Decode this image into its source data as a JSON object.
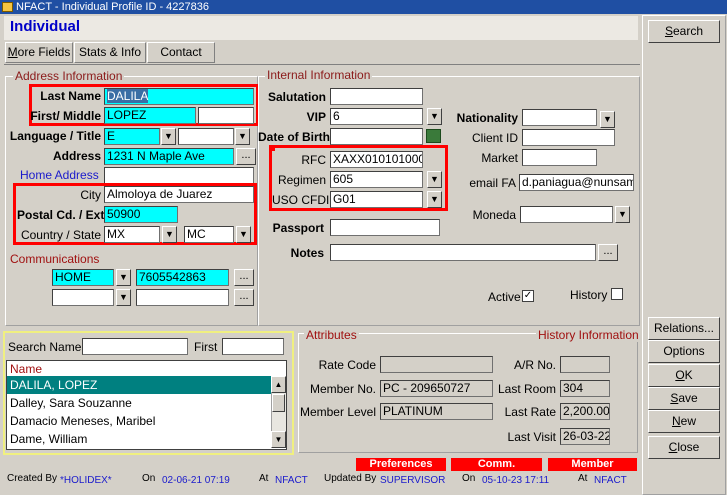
{
  "window": {
    "title": "NFACT - Individual Profile ID - 4227836"
  },
  "page": {
    "title": "Individual"
  },
  "tabs": [
    {
      "label": "More Fields"
    },
    {
      "label": "Stats & Info"
    },
    {
      "label": "Contact"
    }
  ],
  "address": {
    "section": "Address Information",
    "last_name_label": "Last Name",
    "last_name": "DALILA",
    "first_middle_label": "First/ Middle",
    "first_name": "LOPEZ",
    "middle_name": "",
    "language_title_label": "Language / Title",
    "language": "E",
    "title": "",
    "address_label": "Address",
    "address": "1231 N Maple Ave",
    "home_address_label": "Home Address",
    "home_address": "",
    "city_label": "City",
    "city": "Almoloya de Juarez",
    "postal_label": "Postal Cd. / Ext.",
    "postal_code": "50900",
    "country_state_label": "Country / State",
    "country": "MX",
    "state": "MC"
  },
  "communications": {
    "section": "Communications",
    "type1": "HOME",
    "value1": "7605542863",
    "type2": "",
    "value2": ""
  },
  "internal": {
    "section": "Internal Information",
    "salutation_label": "Salutation",
    "salutation": "",
    "vip_label": "VIP",
    "vip": "6",
    "dob_label": "Date of Birth",
    "dob": "",
    "rfc_label": "RFC",
    "rfc": "XAXX010101000",
    "regimen_label": "Regimen",
    "regimen": "605",
    "uso_cfdi_label": "USO CFDI",
    "uso_cfdi": "G01",
    "passport_label": "Passport",
    "passport": "",
    "notes_label": "Notes",
    "notes": "",
    "nationality_label": "Nationality",
    "nationality": "",
    "client_id_label": "Client ID",
    "client_id": "",
    "market_label": "Market",
    "market": "",
    "email_label": "email FA",
    "email": "d.paniagua@nunsam",
    "moneda_label": "Moneda",
    "moneda": "",
    "active_label": "Active",
    "active_mark": "✓",
    "history_label": "History"
  },
  "search": {
    "name_label": "Search Name",
    "name_value": "",
    "first_label": "First",
    "first_value": "",
    "column_header": "Name",
    "results": [
      "DALILA, LOPEZ",
      "Dalley, Sara Souzanne",
      "Damacio Meneses, Maribel",
      "Dame, William"
    ]
  },
  "attributes": {
    "title": "Attributes",
    "history_title": "History Information",
    "rate_code_label": "Rate Code",
    "rate_code": "",
    "member_no_label": "Member No.",
    "member_no": "PC - 209650727",
    "member_level_label": "Member Level",
    "member_level": "PLATINUM",
    "ar_no_label": "A/R No.",
    "ar_no": "",
    "last_room_label": "Last Room",
    "last_room": "304",
    "last_rate_label": "Last Rate",
    "last_rate": "2,200.00",
    "last_visit_label": "Last Visit",
    "last_visit": "26-03-22"
  },
  "side_buttons": {
    "search": "Search",
    "relations": "Relations...",
    "options": "Options",
    "ok": "OK",
    "save": "Save",
    "new": "New",
    "close": "Close"
  },
  "flags": {
    "preferences": "Preferences",
    "comm": "Comm.",
    "member": "Member"
  },
  "footer": {
    "created_by_label": "Created By",
    "created_by": "*HOLIDEX*",
    "on_label": "On",
    "created_on": "02-06-21 07:19",
    "at_label": "At",
    "created_at": "NFACT",
    "updated_by_label": "Updated By",
    "updated_by": "SUPERVISOR",
    "updated_on": "05-10-23 17:11",
    "updated_at": "NFACT"
  },
  "colors": {
    "title_blue": "#1f4fa3",
    "highlight_cyan": "#00ffff",
    "callout_red": "#ff0000",
    "selected_row": "#008080"
  }
}
